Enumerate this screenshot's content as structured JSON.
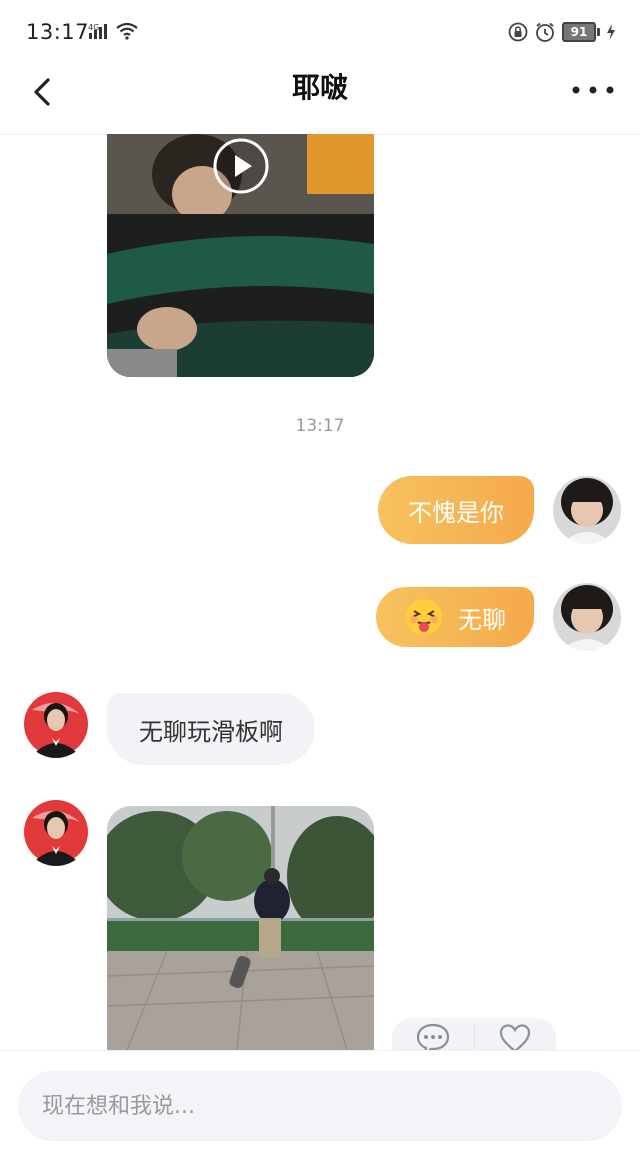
{
  "status_bar": {
    "time": "13:17",
    "network": "4G",
    "battery": "91",
    "icons": [
      "signal-icon",
      "wifi-icon",
      "lock-icon",
      "alarm-icon",
      "battery-icon",
      "charging-icon"
    ]
  },
  "nav": {
    "title": "耶啵",
    "back_icon": "chevron-left-icon",
    "more_icon": "more-dots-icon"
  },
  "messages": [
    {
      "type": "video",
      "direction": "incoming",
      "icon": "play-icon"
    },
    {
      "type": "timestamp",
      "text": "13:17"
    },
    {
      "type": "text",
      "direction": "outgoing",
      "text": "不愧是你"
    },
    {
      "type": "emoji-text",
      "direction": "outgoing",
      "text": "无聊",
      "emoji": "tongue-face-emoji"
    },
    {
      "type": "text",
      "direction": "incoming",
      "text": "无聊玩滑板啊"
    },
    {
      "type": "video",
      "direction": "incoming",
      "reactions": [
        "comment-icon",
        "heart-icon"
      ]
    }
  ],
  "input": {
    "placeholder": "现在想和我说..."
  },
  "colors": {
    "outgoing_bubble_start": "#f7c25f",
    "outgoing_bubble_end": "#f6a94a",
    "incoming_bubble": "#f2f3f6"
  }
}
